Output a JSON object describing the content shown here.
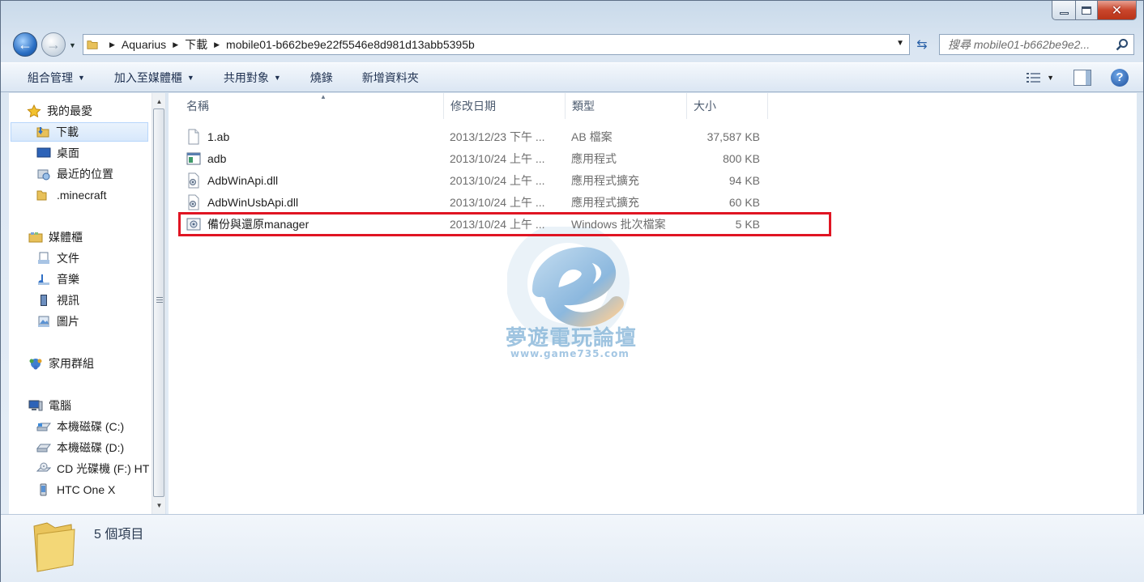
{
  "address": {
    "crumbs": [
      "Aquarius",
      "下載",
      "mobile01-b662be9e22f5546e8d981d13abb5395b"
    ]
  },
  "search": {
    "placeholder": "搜尋 mobile01-b662be9e2..."
  },
  "toolbar": {
    "organize": "組合管理",
    "add_to_library": "加入至媒體櫃",
    "share_with": "共用對象",
    "burn": "燒錄",
    "new_folder": "新增資料夾"
  },
  "sidebar": {
    "favorites": {
      "label": "我的最愛",
      "items": [
        {
          "label": "下載",
          "icon": "download-folder-icon",
          "selected": true
        },
        {
          "label": "桌面",
          "icon": "desktop-icon"
        },
        {
          "label": "最近的位置",
          "icon": "recent-places-icon"
        },
        {
          "label": ".minecraft",
          "icon": "folder-icon"
        }
      ]
    },
    "libraries": {
      "label": "媒體櫃",
      "items": [
        {
          "label": "文件",
          "icon": "documents-icon"
        },
        {
          "label": "音樂",
          "icon": "music-icon"
        },
        {
          "label": "視訊",
          "icon": "videos-icon"
        },
        {
          "label": "圖片",
          "icon": "pictures-icon"
        }
      ]
    },
    "homegroup": {
      "label": "家用群組"
    },
    "computer": {
      "label": "電腦",
      "items": [
        {
          "label": "本機磁碟 (C:)",
          "icon": "drive-c-icon"
        },
        {
          "label": "本機磁碟 (D:)",
          "icon": "drive-d-icon"
        },
        {
          "label": "CD 光碟機 (F:) HT",
          "icon": "cd-drive-icon"
        },
        {
          "label": "HTC One X",
          "icon": "phone-icon"
        }
      ]
    }
  },
  "columns": [
    "名稱",
    "修改日期",
    "類型",
    "大小"
  ],
  "files": [
    {
      "name": "1.ab",
      "date": "2013/12/23 下午 ...",
      "type": "AB 檔案",
      "size": "37,587 KB",
      "icon": "blank-file-icon"
    },
    {
      "name": "adb",
      "date": "2013/10/24 上午 ...",
      "type": "應用程式",
      "size": "800 KB",
      "icon": "application-icon"
    },
    {
      "name": "AdbWinApi.dll",
      "date": "2013/10/24 上午 ...",
      "type": "應用程式擴充",
      "size": "94 KB",
      "icon": "dll-icon"
    },
    {
      "name": "AdbWinUsbApi.dll",
      "date": "2013/10/24 上午 ...",
      "type": "應用程式擴充",
      "size": "60 KB",
      "icon": "dll-icon"
    },
    {
      "name": "備份與還原manager",
      "date": "2013/10/24 上午 ...",
      "type": "Windows 批次檔案",
      "size": "5 KB",
      "icon": "batch-file-icon"
    }
  ],
  "watermark": {
    "text": "夢遊電玩論壇",
    "url": "www.game735.com"
  },
  "details": {
    "item_count": "5 個項目"
  },
  "colors": {
    "highlight": "#e01523",
    "accent": "#2a6fc4"
  }
}
